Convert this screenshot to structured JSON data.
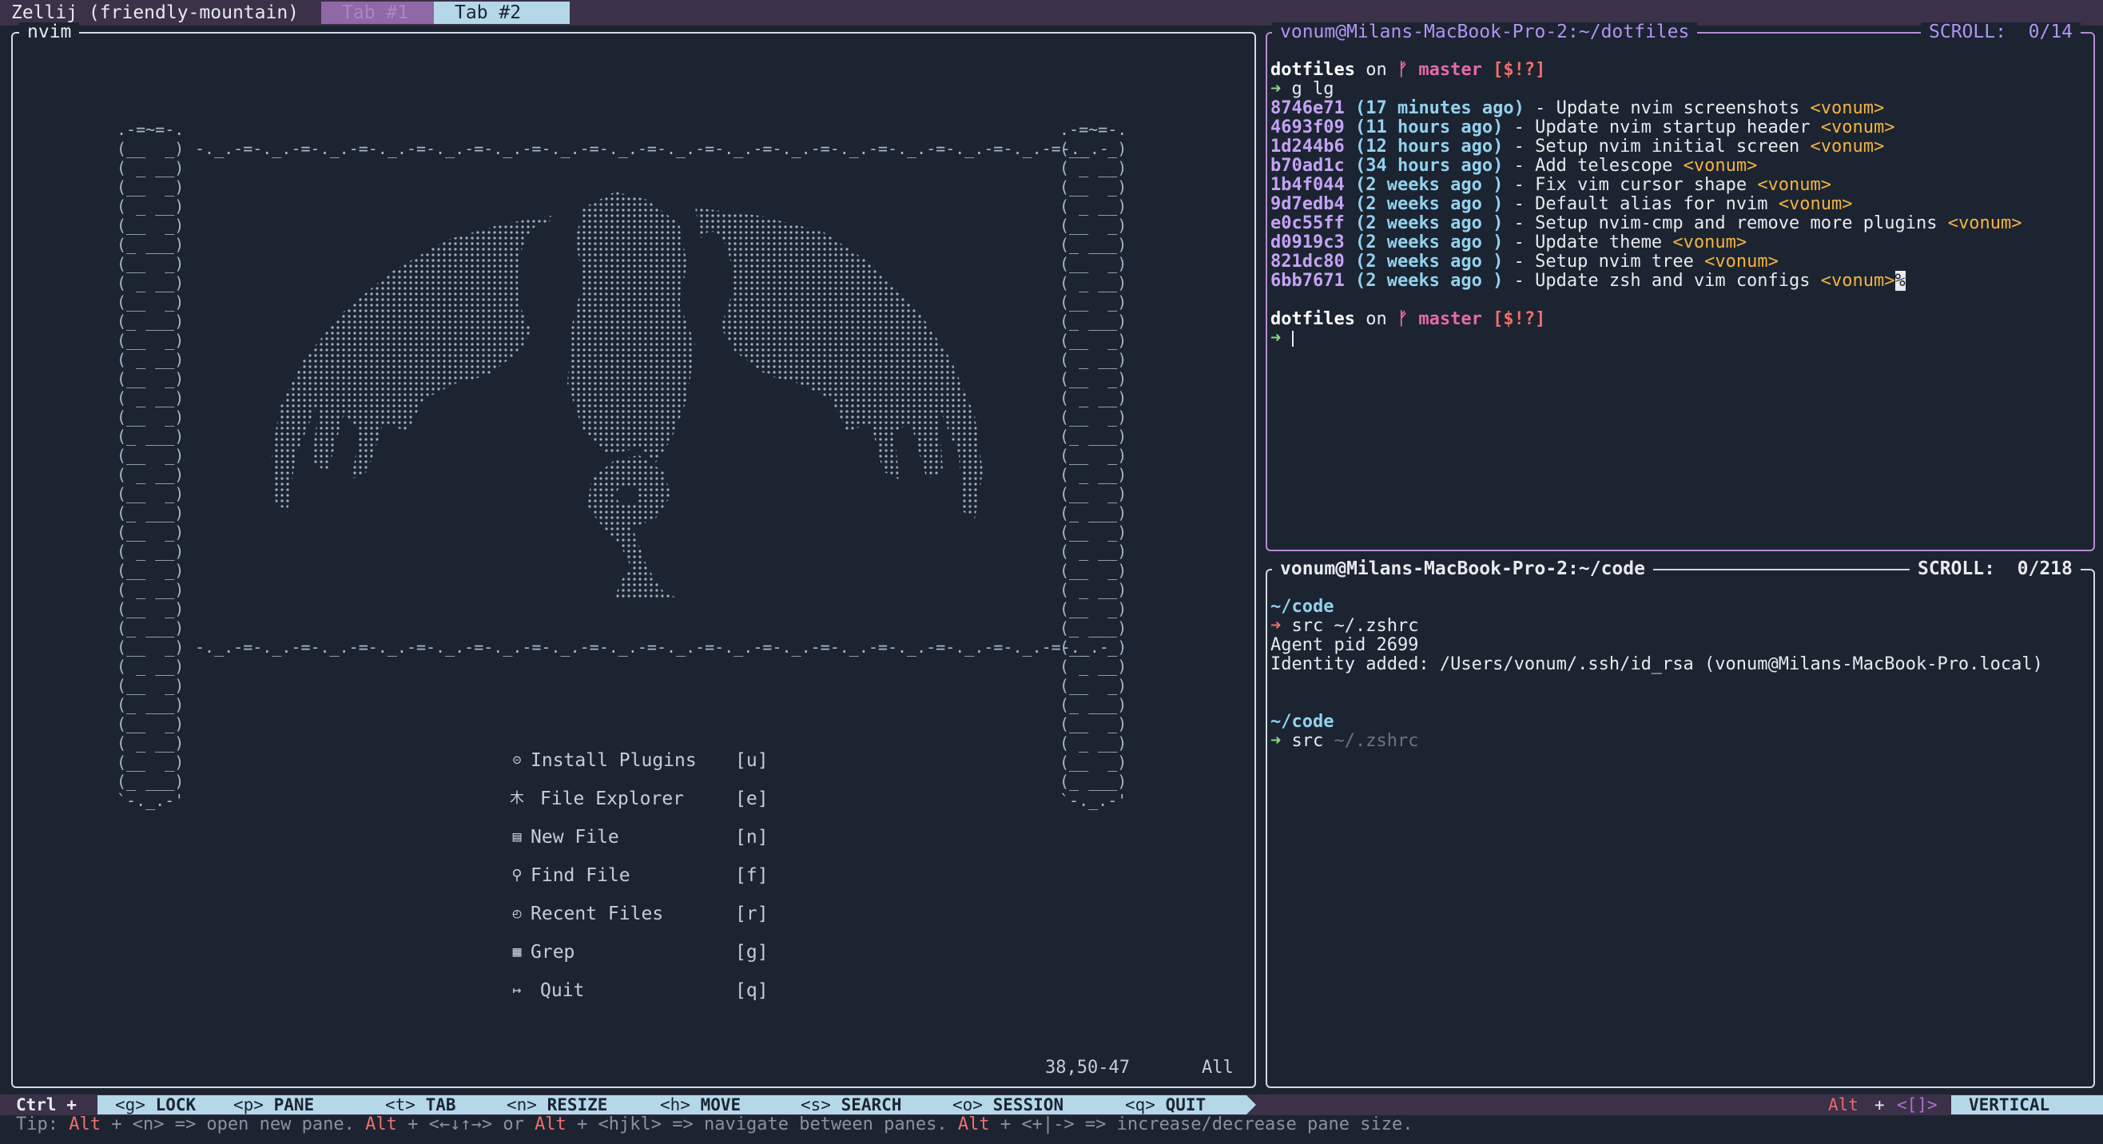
{
  "topbar": {
    "title": "Zellij (friendly-mountain)",
    "tabs": [
      {
        "label": "Tab #1",
        "active": false
      },
      {
        "label": "Tab #2",
        "active": true
      }
    ]
  },
  "nvim_pane": {
    "title": "nvim",
    "menu": [
      {
        "icon": "⊝",
        "icon_name": "plugin-icon",
        "label": "Install Plugins",
        "key": "[u]"
      },
      {
        "icon": "木",
        "icon_name": "tree-icon",
        "label": "File Explorer",
        "key": "[e]"
      },
      {
        "icon": "▤",
        "icon_name": "file-icon",
        "label": "New File",
        "key": "[n]"
      },
      {
        "icon": "⚲",
        "icon_name": "search-icon",
        "label": "Find File",
        "key": "[f]"
      },
      {
        "icon": "◴",
        "icon_name": "history-icon",
        "label": "Recent Files",
        "key": "[r]"
      },
      {
        "icon": "▦",
        "icon_name": "grep-icon",
        "label": "Grep",
        "key": "[g]"
      },
      {
        "icon": "↦",
        "icon_name": "exit-icon",
        "label": "Quit",
        "key": "[q]"
      }
    ],
    "cursor_pos": "38,50-47",
    "scroll_pos": "All"
  },
  "dotfiles_pane": {
    "title": "vonum@Milans-MacBook-Pro-2:~/dotfiles",
    "scroll": "SCROLL:  0/14",
    "prompt_dir": "dotfiles",
    "prompt_on": "on",
    "branch_icon": "ᚠ",
    "branch": "master",
    "status": "[$!?]",
    "arrow": "➜",
    "command": "g lg",
    "commits": [
      {
        "hash": "8746e71",
        "time": "(17 minutes ago)",
        "msg": "Update nvim screenshots",
        "author": "<vonum>"
      },
      {
        "hash": "4693f09",
        "time": "(11 hours ago)",
        "msg": "Update nvim startup header",
        "author": "<vonum>"
      },
      {
        "hash": "1d244b6",
        "time": "(12 hours ago)",
        "msg": "Setup nvim initial screen",
        "author": "<vonum>"
      },
      {
        "hash": "b70ad1c",
        "time": "(34 hours ago)",
        "msg": "Add telescope",
        "author": "<vonum>"
      },
      {
        "hash": "1b4f044",
        "time": "(2 weeks ago )",
        "msg": "Fix vim cursor shape",
        "author": "<vonum>"
      },
      {
        "hash": "9d7edb4",
        "time": "(2 weeks ago )",
        "msg": "Default alias for nvim",
        "author": "<vonum>"
      },
      {
        "hash": "e0c55ff",
        "time": "(2 weeks ago )",
        "msg": "Setup nvim-cmp and remove more plugins",
        "author": "<vonum>"
      },
      {
        "hash": "d0919c3",
        "time": "(2 weeks ago )",
        "msg": "Update theme",
        "author": "<vonum>"
      },
      {
        "hash": "821dc80",
        "time": "(2 weeks ago )",
        "msg": "Setup nvim tree",
        "author": "<vonum>"
      },
      {
        "hash": "6bb7671",
        "time": "(2 weeks ago )",
        "msg": "Update zsh and vim configs",
        "author": "<vonum>"
      }
    ],
    "sep": "-",
    "end_marker": "%"
  },
  "code_pane": {
    "title": "vonum@Milans-MacBook-Pro-2:~/code",
    "scroll": "SCROLL:  0/218",
    "dir": "~/code",
    "arrow": "➜",
    "command": "src ~/.zshrc",
    "output": [
      "Agent pid 2699",
      "Identity added: /Users/vonum/.ssh/id_rsa (vonum@Milans-MacBook-Pro.local)"
    ],
    "typed": "src",
    "suggestion": " ~/.zshrc"
  },
  "statusbar": {
    "prefix": "Ctrl +",
    "items": [
      {
        "key": "<g>",
        "label": "LOCK"
      },
      {
        "key": "<p>",
        "label": "PANE"
      },
      {
        "key": "<t>",
        "label": "TAB"
      },
      {
        "key": "<n>",
        "label": "RESIZE"
      },
      {
        "key": "<h>",
        "label": "MOVE"
      },
      {
        "key": "<s>",
        "label": "SEARCH"
      },
      {
        "key": "<o>",
        "label": "SESSION"
      },
      {
        "key": "<q>",
        "label": "QUIT"
      }
    ],
    "right_alt": "Alt",
    "right_plus": "+",
    "right_keys": "<[]>",
    "right_mode": "VERTICAL"
  },
  "tip": {
    "label": "Tip:",
    "alt": "Alt",
    "p1": " + <n> => open new pane. ",
    "p2": " + <←↓↑→> or ",
    "p3": " + <hjkl> => navigate between panes. ",
    "p4": " + <+|-> => increase/decrease pane size."
  },
  "colors": {
    "background": "#1c2431",
    "bar": "#3b3149",
    "active_tab": "#b4d8e8",
    "inactive_tab": "#8f68a6",
    "accent_cyan": "#92d2ef",
    "accent_pink": "#e86aa8",
    "accent_red": "#f0706d",
    "accent_orange": "#f3b341",
    "accent_purple": "#b193f3"
  }
}
